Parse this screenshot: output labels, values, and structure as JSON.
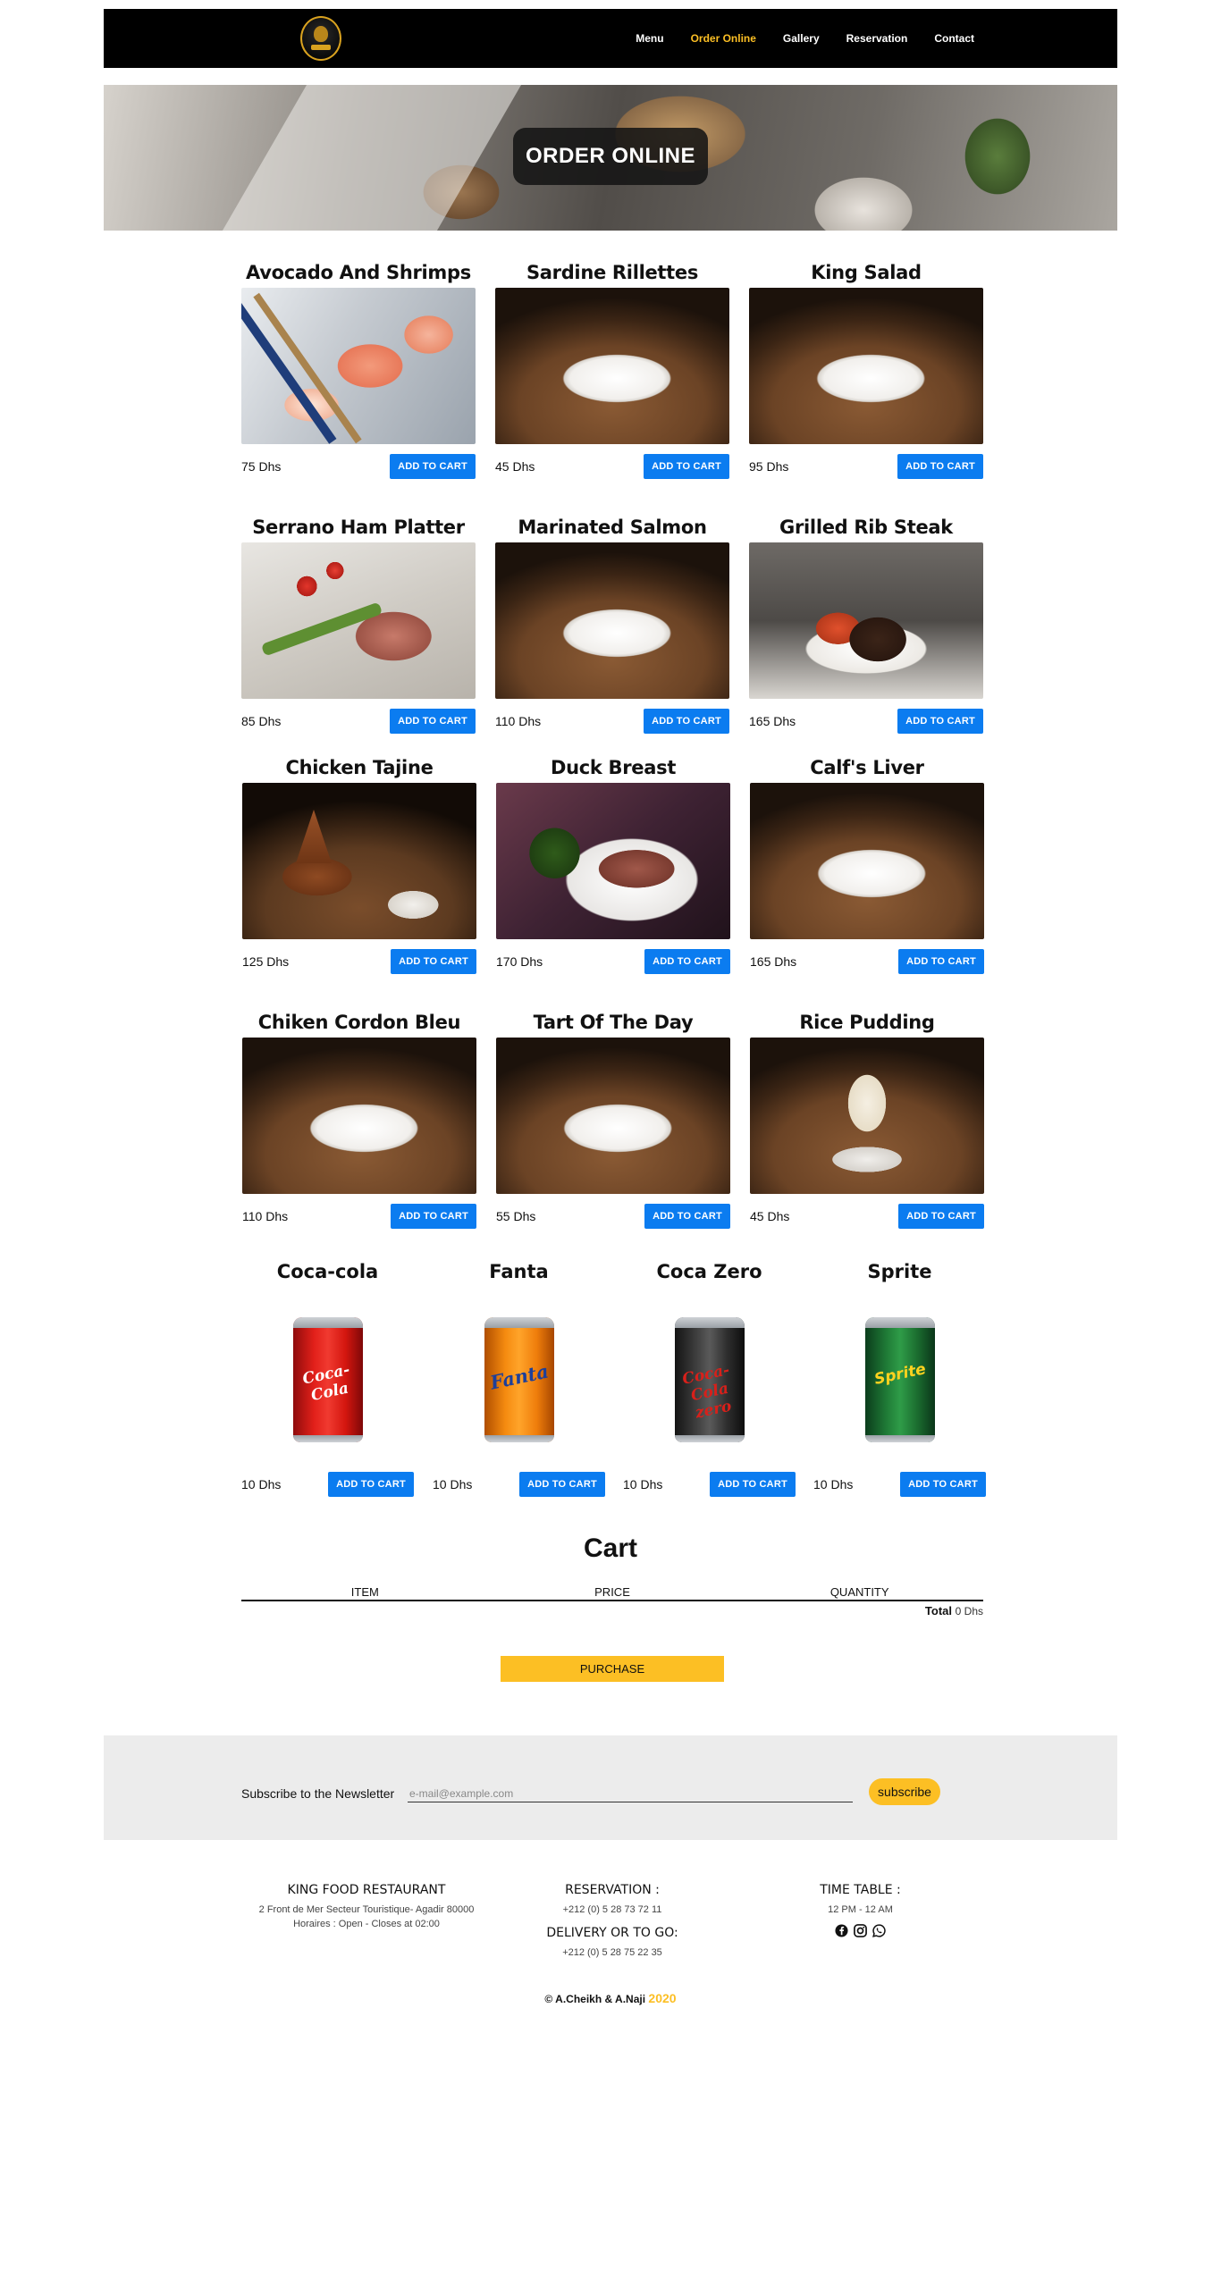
{
  "nav": {
    "items": [
      {
        "label": "Menu",
        "active": false
      },
      {
        "label": "Order Online",
        "active": true
      },
      {
        "label": "Gallery",
        "active": false
      },
      {
        "label": "Reservation",
        "active": false
      },
      {
        "label": "Contact",
        "active": false
      }
    ],
    "active_color": "#fcbf24"
  },
  "hero": {
    "title": "ORDER ONLINE"
  },
  "add_to_cart_label": "ADD TO CART",
  "products": [
    {
      "name": "Avocado And Shrimps",
      "price": "75 Dhs",
      "image": "sushi-plate"
    },
    {
      "name": "Sardine Rillettes",
      "price": "45 Dhs",
      "image": "plated-dish"
    },
    {
      "name": "King Salad",
      "price": "95 Dhs",
      "image": "plated-dish"
    },
    {
      "name": "Serrano Ham Platter",
      "price": "85 Dhs",
      "image": "ham-platter"
    },
    {
      "name": "Marinated Salmon",
      "price": "110 Dhs",
      "image": "plated-dish"
    },
    {
      "name": "Grilled Rib Steak",
      "price": "165 Dhs",
      "image": "steak-plate"
    },
    {
      "name": "Chicken Tajine",
      "price": "125 Dhs",
      "image": "tajine"
    },
    {
      "name": "Duck Breast",
      "price": "170 Dhs",
      "image": "duck-plate"
    },
    {
      "name": "Calf's Liver",
      "price": "165 Dhs",
      "image": "plated-dish"
    },
    {
      "name": "Chiken Cordon Bleu",
      "price": "110 Dhs",
      "image": "plated-dish"
    },
    {
      "name": "Tart Of The Day",
      "price": "55 Dhs",
      "image": "plated-dish"
    },
    {
      "name": "Rice Pudding",
      "price": "45 Dhs",
      "image": "dessert-cup"
    }
  ],
  "drinks": [
    {
      "name": "Coca-cola",
      "price": "10 Dhs",
      "can_text": "Coca-Cola"
    },
    {
      "name": "Fanta",
      "price": "10 Dhs",
      "can_text": "Fanta"
    },
    {
      "name": "Coca Zero",
      "price": "10 Dhs",
      "can_text": "Coca-Cola zero"
    },
    {
      "name": "Sprite",
      "price": "10 Dhs",
      "can_text": "Sprite"
    }
  ],
  "cart": {
    "title": "Cart",
    "columns": [
      "ITEM",
      "PRICE",
      "QUANTITY"
    ],
    "total_label": "Total",
    "total_value": "0 Dhs",
    "purchase_label": "PURCHASE"
  },
  "newsletter": {
    "label": "Subscribe to the Newsletter",
    "placeholder": "e-mail@example.com",
    "button": "subscribe"
  },
  "footer": {
    "restaurant": {
      "heading": "KING FOOD RESTAURANT",
      "address": "2 Front de Mer Secteur Touristique- Agadir 80000",
      "hours": "Horaires : Open - Closes at 02:00"
    },
    "reservation": {
      "heading": "RESERVATION :",
      "phone": "+212 (0) 5 28 73 72 11",
      "delivery_heading": "DELIVERY OR TO GO:",
      "delivery_phone": "+212 (0) 5 28 75 22 35"
    },
    "timetable": {
      "heading": "TIME TABLE :",
      "hours": "12 PM - 12 AM",
      "socials": [
        "facebook-icon",
        "instagram-icon",
        "whatsapp-icon"
      ]
    },
    "copyright": "© A.Cheikh & A.Naji",
    "year": "2020"
  },
  "colors": {
    "button_blue": "#0b7cf0",
    "accent_yellow": "#fcbf24",
    "nav_bg": "#000000"
  }
}
